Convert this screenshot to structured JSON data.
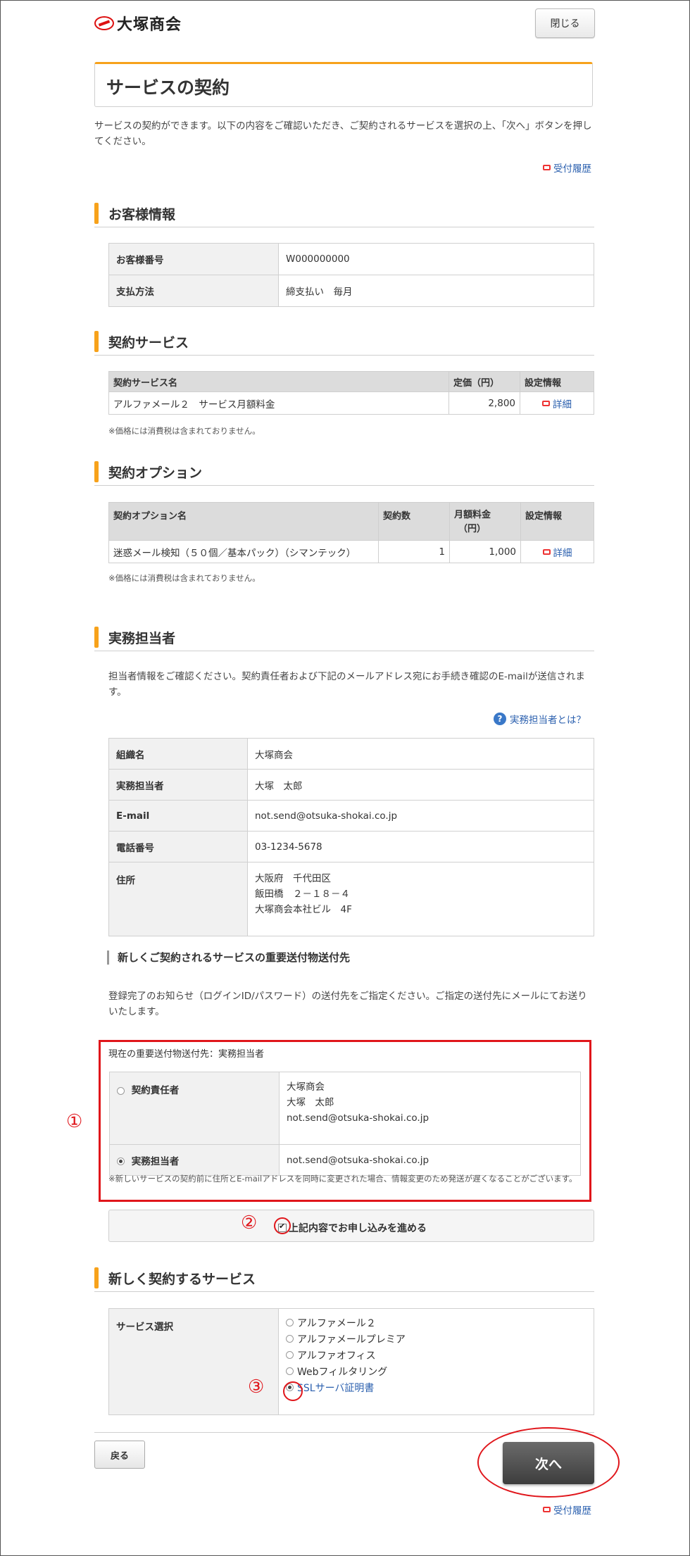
{
  "brand": {
    "name": "大塚商会"
  },
  "header": {
    "close_label": "閉じる"
  },
  "page": {
    "title": "サービスの契約",
    "lead": "サービスの契約ができます。以下の内容をご確認いただき、ご契約されるサービスを選択の上、「次へ」ボタンを押してください。",
    "history_link": "受付履歴"
  },
  "customer": {
    "heading": "お客様情報",
    "rows": [
      {
        "label": "お客様番号",
        "value": "W000000000"
      },
      {
        "label": "支払方法",
        "value": "締支払い　毎月"
      }
    ]
  },
  "contract_service": {
    "heading": "契約サービス",
    "columns": [
      "契約サービス名",
      "定価（円）",
      "設定情報"
    ],
    "rows": [
      {
        "name": "アルファメール２　サービス月額料金",
        "price": "2,800",
        "link": "詳細"
      }
    ],
    "note": "※価格には消費税は含まれておりません。"
  },
  "contract_option": {
    "heading": "契約オプション",
    "columns": [
      "契約オプション名",
      "契約数",
      "月額料金",
      "（円）",
      "設定情報"
    ],
    "rows": [
      {
        "name": "迷惑メール検知（５０個／基本パック）（シマンテック）",
        "count": "1",
        "price": "1,000",
        "link": "詳細"
      }
    ],
    "note": "※価格には消費税は含まれておりません。"
  },
  "staff": {
    "heading": "実務担当者",
    "description": "担当者情報をご確認ください。契約責任者および下記のメールアドレス宛にお手続き確認のE-mailが送信されます。",
    "help_link": "実務担当者とは？",
    "rows": [
      {
        "label": "組織名",
        "value": "大塚商会"
      },
      {
        "label": "実務担当者",
        "value": "大塚　太郎"
      },
      {
        "label": "E-mail",
        "value": "not.send@otsuka-shokai.co.jp"
      },
      {
        "label": "電話番号",
        "value": "03-1234-5678"
      }
    ],
    "address": {
      "label": "住所",
      "line1": "大阪府　千代田区",
      "line2": "飯田橋　２－１８－４",
      "line3": "大塚商会本社ビル　4F"
    }
  },
  "delivery": {
    "heading": "新しくご契約されるサービスの重要送付物送付先",
    "description": "登録完了のお知らせ（ログインID/パスワード）の送付先をご指定ください。ご指定の送付先にメールにてお送りいたします。",
    "current": "現在の重要送付物送付先：実務担当者",
    "options": [
      {
        "label": "契約責任者",
        "line1": "大塚商会",
        "line2": "大塚　太郎",
        "line3": "not.send@otsuka-shokai.co.jp",
        "selected": false
      },
      {
        "label": "実務担当者",
        "line1": "not.send@otsuka-shokai.co.jp",
        "selected": true
      }
    ],
    "note": "※新しいサービスの契約前に住所とE-mailアドレスを同時に変更された場合、情報変更のため発送が遅くなることがございます。"
  },
  "agree": {
    "label": "上記内容でお申し込みを進める",
    "checked": true
  },
  "markers": {
    "m1": "①",
    "m2": "②",
    "m3": "③"
  },
  "new_service": {
    "heading": "新しく契約するサービス",
    "label": "サービス選択",
    "options": [
      {
        "label": "アルファメール２",
        "selected": false
      },
      {
        "label": "アルファメールプレミア",
        "selected": false
      },
      {
        "label": "アルファオフィス",
        "selected": false
      },
      {
        "label": "Webフィルタリング",
        "selected": false
      },
      {
        "label": "SSLサーバ証明書",
        "selected": true
      }
    ]
  },
  "footer": {
    "back_label": "戻る",
    "next_label": "次へ",
    "history_link": "受付履歴"
  },
  "colors": {
    "accent": "#f7a21b",
    "link": "#2a5fae",
    "annotation": "#e0161b",
    "next_button": "#4a4a4a"
  }
}
